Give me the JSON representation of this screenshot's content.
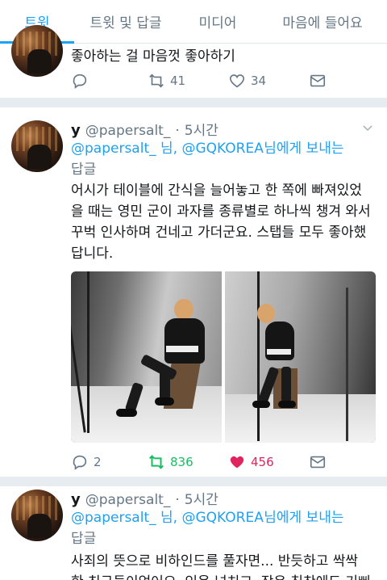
{
  "tabs": [
    {
      "label": "트윗",
      "active": true
    },
    {
      "label": "트윗 및 답글",
      "active": false
    },
    {
      "label": "미디어",
      "active": false
    },
    {
      "label": "마음에 들어요",
      "active": false
    }
  ],
  "colors": {
    "accent": "#1da1f2",
    "retweet_active": "#17bf63",
    "like_active": "#e0245e",
    "muted": "#657786"
  },
  "tweet0": {
    "text": "좋아하는 걸 마음껏 좋아하기",
    "retweets": "41",
    "likes": "34"
  },
  "tweet1": {
    "name": "y",
    "handle": "@papersalt_",
    "dot": "·",
    "time": "5시간",
    "reply_mention_1": "@papersalt_",
    "reply_mid": "님, ",
    "reply_mention_2": "@GQKOREA",
    "reply_suffix_1": "님에게 보내는",
    "reply_suffix_2": "답글",
    "text_lines": [
      "어시가 테이블에 간식을 늘어놓고 한 쪽에 빠져있었",
      "을 때는 영민 군이 과자를 종류별로 하나씩 챙겨 와서",
      "꾸벅 인사하며 건네고 가더군요. 스탭들 모두 좋아했",
      "답니다."
    ],
    "replies": "2",
    "retweets": "836",
    "likes": "456"
  },
  "tweet2": {
    "name": "y",
    "handle": "@papersalt_",
    "dot": "·",
    "time": "5시간",
    "reply_mention_1": "@papersalt_",
    "reply_mid": "님, ",
    "reply_mention_2": "@GQKOREA",
    "reply_suffix_1": "님에게 보내는",
    "reply_suffix_2": "답글",
    "text_lines": [
      "사죄의 뜻으로 비하인드를 풀자면... 반듯하고 싹싹",
      "한 친구들이었어요. 인용 넘치고, 작은 칭찬에도 기뻐"
    ]
  }
}
